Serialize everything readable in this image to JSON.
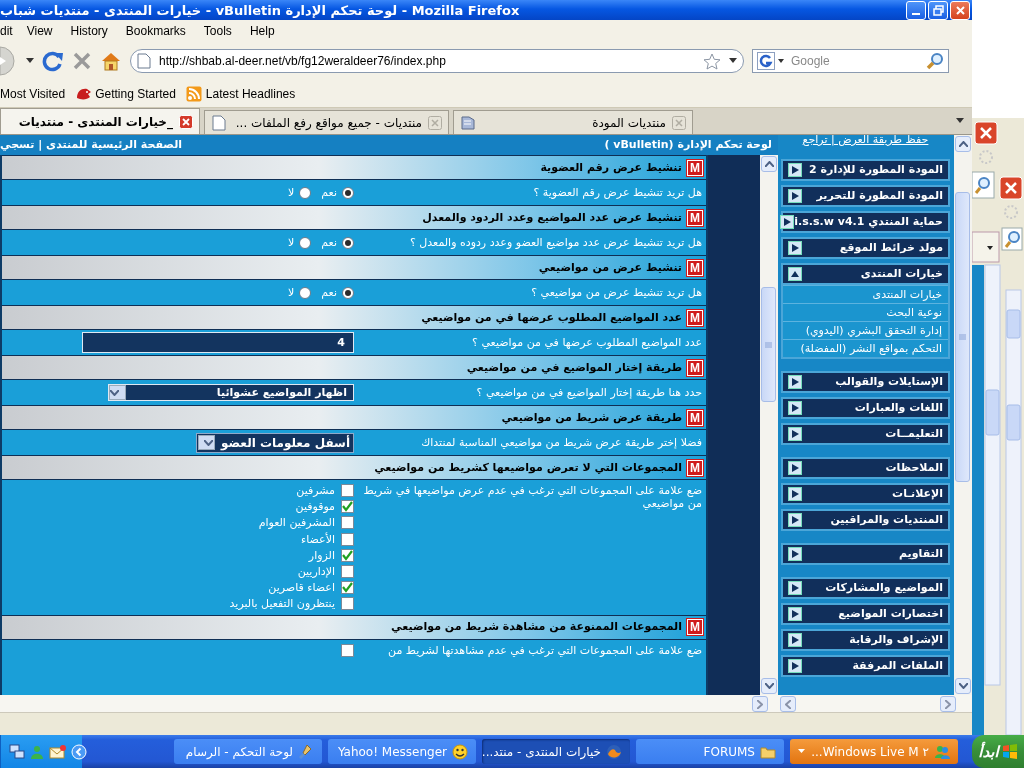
{
  "window": {
    "title": "خيارات المنتدى - منتديات شباب - vBulletin لوحة تحكم الإدارة - Mozilla Firefox"
  },
  "menu": [
    "Help",
    "Tools",
    "Bookmarks",
    "History",
    "View",
    "dit"
  ],
  "toolbar": {
    "url": "http://shbab.al-deer.net/vb/fg12weraldeer76/index.php",
    "search": {
      "placeholder": "Google"
    }
  },
  "bookmarks": [
    "Latest Headlines",
    "Getting Started",
    "Most Visited"
  ],
  "tabs": [
    {
      "label": "منتديات المودة",
      "selected": false
    },
    {
      "label": "منتديات - جميع مواقع رفع الملفات ...",
      "selected": false
    },
    {
      "label": "_خيارات المنتدى - منتديات",
      "selected": true
    }
  ],
  "page": {
    "header": {
      "links": "الصفحة الرئيسية للمنتدى | تسجي",
      "title": "لوحة تحكم الإدارة (vBulletin )"
    },
    "sections": [
      {
        "badge": "M",
        "title": "تنشيط عرض رقم العضوية",
        "kind": "radio",
        "question": "هل تريد تنشيط عرض رقم العضوية ؟",
        "options": [
          {
            "label": "نعم",
            "selected": true
          },
          {
            "label": "لا",
            "selected": false
          }
        ]
      },
      {
        "badge": "M",
        "title": "تنشيط عرض عدد المواضيع وعدد الردود والمعدل",
        "kind": "radio",
        "question": "هل تريد تنشيط عرض عدد مواضيع العضو وعدد ردوده والمعدل ؟",
        "options": [
          {
            "label": "نعم",
            "selected": true
          },
          {
            "label": "لا",
            "selected": false
          }
        ]
      },
      {
        "badge": "M",
        "title": "تنشيط عرض من مواضيعي",
        "kind": "radio",
        "question": "هل تريد تنشيط عرض من مواضيعي ؟",
        "options": [
          {
            "label": "نعم",
            "selected": true
          },
          {
            "label": "لا",
            "selected": false
          }
        ]
      },
      {
        "badge": "M",
        "title": "عدد المواضيع المطلوب عرضها في من مواضيعي",
        "kind": "number",
        "question": "عدد المواضيع المطلوب عرضها في من مواضيعي ؟",
        "value": "4"
      },
      {
        "badge": "M",
        "title": "طريقة إختار المواضيع في من مواضيعي",
        "kind": "select",
        "question": "حدد هنا طريقة إختار المواضيع في من مواضيعي ؟",
        "value": "اظهار المواضيع عشوائيا"
      },
      {
        "badge": "M",
        "title": "طريقة عرض شريط من مواضيعي",
        "kind": "select_small",
        "question": "فضلا إختر طريقة عرض شريط من مواضيعي المناسبة لمنتداك",
        "value": "أسفل معلومات العضو"
      },
      {
        "badge": "M",
        "title": "المجموعات التي لا تعرض مواضيعها كشريط من مواضيعي",
        "kind": "checklist",
        "question": "ضع علامة على المجموعات التي ترغب في عدم عرض مواضيعها في شريط من مواضيعي",
        "options": [
          {
            "label": "مشرفين",
            "checked": false
          },
          {
            "label": "موقوفين",
            "checked": true
          },
          {
            "label": "المشرفين العوام",
            "checked": false
          },
          {
            "label": "الأعضاء",
            "checked": false
          },
          {
            "label": "الزوار",
            "checked": true
          },
          {
            "label": "الإداريين",
            "checked": false
          },
          {
            "label": "اعضاء قاصرين",
            "checked": true
          },
          {
            "label": "ينتظرون التفعيل بالبريد",
            "checked": false
          }
        ]
      },
      {
        "badge": "M",
        "title": "المجموعات الممنوعة من مشاهدة شريط من مواضيعي",
        "kind": "checklist",
        "question": "ضع علامة على المجموعات التي ترغب في عدم مشاهدتها لشريط من",
        "options": [
          {
            "checked": false
          }
        ]
      }
    ]
  },
  "sidebar": {
    "top_links": "حفظ طريقة العرض | تراجع",
    "groups": [
      {
        "items": [
          {
            "label": "المودة المطورة للإدارة 2",
            "expanded": false
          },
          {
            "label": "المودة المطورة للتحرير",
            "expanded": false
          },
          {
            "label": "حماية المنتدي i.s.s.w v4.1",
            "expanded": false
          },
          {
            "label": "مولد خرائط الموقع",
            "expanded": false
          },
          {
            "label": "خيارات المنتدى",
            "expanded": true,
            "children": [
              "خيارات المنتدى",
              "نوعية البحث",
              "إدارة التحقق البشري (اليدوي)",
              "التحكم بمواقع النشر (المفضلة)"
            ]
          }
        ]
      },
      {
        "items": [
          {
            "label": "الإستايلات والقوالب",
            "expanded": false
          },
          {
            "label": "اللغات والعبارات",
            "expanded": false
          },
          {
            "label": "التعليمــات",
            "expanded": false
          }
        ]
      },
      {
        "items": [
          {
            "label": "الملاحظات",
            "expanded": false
          },
          {
            "label": "الإعلانـات",
            "expanded": false
          },
          {
            "label": "المنتديات والمراقبين",
            "expanded": false
          }
        ]
      },
      {
        "items": [
          {
            "label": "التقاويم",
            "expanded": false
          }
        ]
      },
      {
        "items": [
          {
            "label": "المواضيع والمشاركات",
            "expanded": false
          },
          {
            "label": "اختصارات المواضيع",
            "expanded": false
          },
          {
            "label": "الإشراف والرقابة",
            "expanded": false
          },
          {
            "label": "الملفات المرفقة",
            "expanded": false
          }
        ]
      }
    ]
  },
  "taskbar": {
    "start": "ابدأ",
    "items": [
      {
        "label": "٢ Windows Live M...",
        "selected": false,
        "attention": true
      },
      {
        "label": "FORUMS",
        "selected": false,
        "attention": false
      },
      {
        "label": "خيارات المنتدى - منتد...",
        "selected": true,
        "attention": false
      },
      {
        "label": "Yahoo! Messenger",
        "selected": false,
        "attention": false
      },
      {
        "label": "لوحة التحكم - الرسام",
        "selected": false,
        "attention": false
      }
    ]
  }
}
